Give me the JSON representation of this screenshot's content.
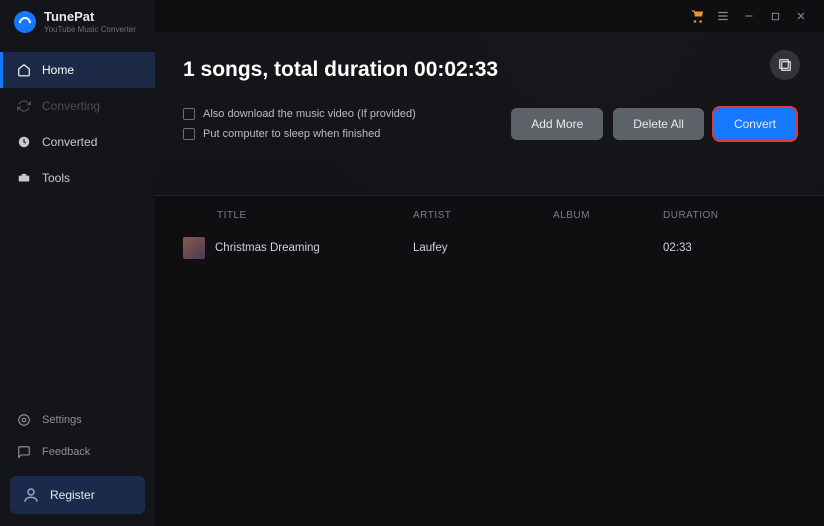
{
  "app": {
    "name": "TunePat",
    "subtitle": "YouTube Music Converter"
  },
  "sidebar": {
    "items": [
      {
        "label": "Home"
      },
      {
        "label": "Converting"
      },
      {
        "label": "Converted"
      },
      {
        "label": "Tools"
      }
    ],
    "bottom": [
      {
        "label": "Settings"
      },
      {
        "label": "Feedback"
      }
    ],
    "register": "Register"
  },
  "hero": {
    "title": "1 songs, total duration 00:02:33",
    "opt_video": "Also download the music video (If provided)",
    "opt_sleep": "Put computer to sleep when finished"
  },
  "buttons": {
    "add_more": "Add More",
    "delete_all": "Delete All",
    "convert": "Convert"
  },
  "table": {
    "headers": {
      "title": "TITLE",
      "artist": "ARTIST",
      "album": "ALBUM",
      "duration": "DURATION"
    },
    "rows": [
      {
        "title": "Christmas Dreaming",
        "artist": "Laufey",
        "album": "",
        "duration": "02:33"
      }
    ]
  }
}
